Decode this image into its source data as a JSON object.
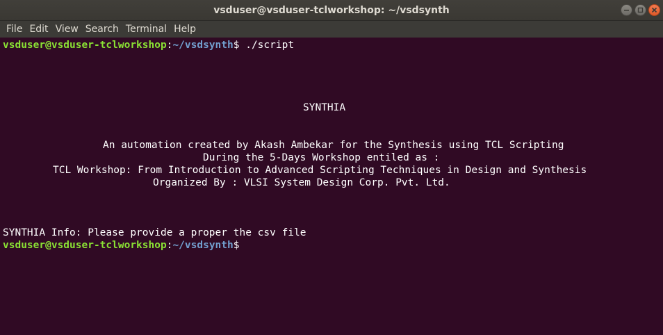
{
  "window": {
    "title": "vsduser@vsduser-tclworkshop: ~/vsdsynth"
  },
  "menu": {
    "items": [
      "File",
      "Edit",
      "View",
      "Search",
      "Terminal",
      "Help"
    ]
  },
  "colors": {
    "terminal_bg": "#300a24",
    "prompt_user": "#8ae234",
    "prompt_path": "#729fcf",
    "text": "#ffffff",
    "close_button": "#e8643a"
  },
  "terminal": {
    "prompt1": {
      "user_host": "vsduser@vsduser-tclworkshop",
      "sep": ":",
      "path": "~/vsdsynth",
      "symbol": "$",
      "command": " ./script"
    },
    "banner": {
      "title": "SYNTHIA",
      "line1": "An automation created by Akash Ambekar for the Synthesis using TCL Scripting",
      "line2": "During the 5-Days Workshop entiled as :",
      "line3": "TCL Workshop: From Introduction to Advanced Scripting Techniques in Design and Synthesis",
      "line4": "Organized By : VLSI System Design Corp. Pvt. Ltd."
    },
    "info": "SYNTHIA Info: Please provide a proper the csv file",
    "prompt2": {
      "user_host": "vsduser@vsduser-tclworkshop",
      "sep": ":",
      "path": "~/vsdsynth",
      "symbol": "$"
    }
  }
}
